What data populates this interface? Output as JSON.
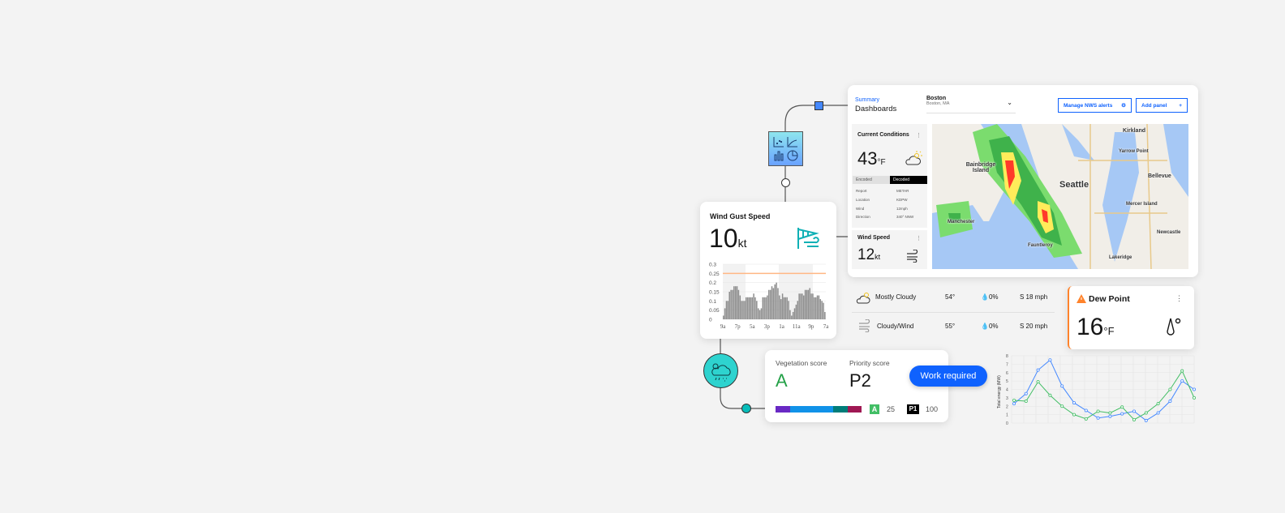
{
  "dashboard": {
    "breadcrumb": "Summary",
    "title": "Dashboards",
    "location": {
      "name": "Boston",
      "sub": "Boston, MA"
    },
    "manage_button": "Manage NWS alerts",
    "add_button": "Add panel",
    "current_conditions": {
      "title": "Current Conditions",
      "value": "43",
      "unit": "°F",
      "tabs": [
        "Encoded",
        "Decoded"
      ],
      "rows": [
        {
          "label": "Report",
          "value": "METAR"
        },
        {
          "label": "Location",
          "value": "KDPW"
        },
        {
          "label": "Wind",
          "value": "12mph"
        },
        {
          "label": "Direction",
          "value": "340° NNW"
        }
      ]
    },
    "wind_speed": {
      "title": "Wind Speed",
      "value": "12",
      "unit": "kt"
    },
    "map_labels": [
      "Kirkland",
      "Yarrow Point",
      "Bainbridge Island",
      "Bellevue",
      "Seattle",
      "Mercer Island",
      "Manchester",
      "Newcastle",
      "Fauntleroy",
      "Lakeridge"
    ]
  },
  "forecast_rows": [
    {
      "icon": "partly-cloudy-icon",
      "condition": "Mostly Cloudy",
      "temp": "54°",
      "precip": "0%",
      "wind": "S 18 mph"
    },
    {
      "icon": "wind-icon",
      "condition": "Cloudy/Wind",
      "temp": "55°",
      "precip": "0%",
      "wind": "S 20 mph"
    }
  ],
  "wind_gust": {
    "title": "Wind Gust Speed",
    "value": "10",
    "unit": "kt"
  },
  "dew_point": {
    "title": "Dew Point",
    "value": "16",
    "unit": "°F",
    "status_color": "#ff832b"
  },
  "vegetation": {
    "veg_label": "Vegetation score",
    "veg_value": "A",
    "priority_label": "Priority score",
    "priority_value": "P2",
    "legend_a_badge": "A",
    "legend_a_value": "25",
    "legend_p_badge": "P1",
    "legend_p_value": "100",
    "segments": [
      {
        "color": "#6929c4",
        "fraction": 0.17
      },
      {
        "color": "#1192e8",
        "fraction": 0.5
      },
      {
        "color": "#007d79",
        "fraction": 0.17
      },
      {
        "color": "#9f1853",
        "fraction": 0.16
      }
    ]
  },
  "work_pill": "Work required",
  "chart_data": [
    {
      "type": "bar",
      "title": "Wind Gust Speed",
      "x_ticks": [
        "9a",
        "7p",
        "5a",
        "3p",
        "1a",
        "11a",
        "9p",
        "7a"
      ],
      "y_ticks": [
        "0",
        "0.05",
        "0.1",
        "0.15",
        "0.2",
        "0.25",
        "0.3"
      ],
      "ylim": [
        0,
        0.3
      ],
      "threshold": 0.25,
      "values": [
        0.02,
        0.06,
        0.1,
        0.1,
        0.15,
        0.16,
        0.16,
        0.18,
        0.18,
        0.18,
        0.16,
        0.13,
        0.1,
        0.1,
        0.1,
        0.12,
        0.12,
        0.12,
        0.12,
        0.12,
        0.14,
        0.12,
        0.1,
        0.06,
        0.05,
        0.06,
        0.12,
        0.12,
        0.12,
        0.13,
        0.16,
        0.16,
        0.18,
        0.17,
        0.19,
        0.2,
        0.17,
        0.13,
        0.11,
        0.14,
        0.12,
        0.12,
        0.12,
        0.1,
        0.05,
        0.02,
        0.04,
        0.06,
        0.08,
        0.1,
        0.14,
        0.14,
        0.14,
        0.13,
        0.16,
        0.16,
        0.16,
        0.17,
        0.14,
        0.14,
        0.12,
        0.12,
        0.13,
        0.13,
        0.11,
        0.1,
        0.09,
        0.04
      ]
    },
    {
      "type": "line",
      "ylabel": "Total energy (MW)",
      "y_ticks": [
        "0",
        "1",
        "2",
        "3",
        "4",
        "5",
        "6",
        "7",
        "8"
      ],
      "ylim": [
        0,
        8
      ],
      "series": [
        {
          "name": "blue",
          "color": "#4589ff",
          "values": [
            2.3,
            3.5,
            6.3,
            7.5,
            4.4,
            2.4,
            1.5,
            0.6,
            0.8,
            1.1,
            1.4,
            0.3,
            1.2,
            2.6,
            5.0,
            4.0
          ]
        },
        {
          "name": "green",
          "color": "#42be65",
          "values": [
            2.7,
            2.6,
            4.9,
            3.3,
            2.0,
            1.0,
            0.5,
            1.4,
            1.2,
            1.9,
            0.4,
            1.2,
            2.3,
            4.0,
            6.2,
            3.0
          ]
        }
      ]
    }
  ]
}
